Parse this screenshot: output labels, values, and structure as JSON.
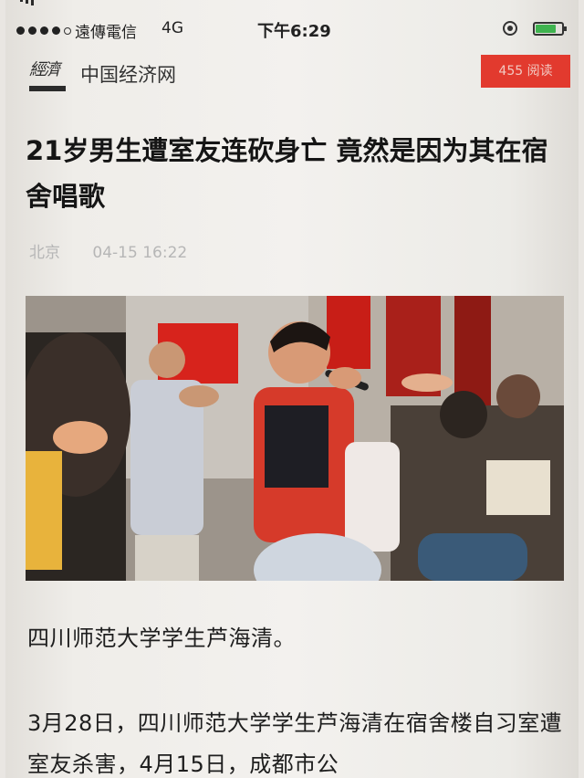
{
  "status_bar": {
    "carrier": "遠傳電信",
    "network": "4G",
    "time": "下午6:29",
    "battery_level": 0.8
  },
  "source": {
    "logo_icon": "zhongguo-jingji-logo",
    "name": "中国经济网",
    "views_badge": "455 阅读"
  },
  "article": {
    "title": "21岁男生遭室友连砍身亡 竟然是因为其在宿舍唱歌",
    "meta_source": "北京",
    "meta_datetime": "04-15 16:22",
    "paragraphs": [
      "四川师范大学学生芦海清。",
      "3月28日，四川师范大学学生芦海清在宿舍楼自习室遭室友杀害，4月15日，成都市公"
    ]
  },
  "colors": {
    "accent_red": "#e23a2e",
    "battery_green": "#3fb34f",
    "meta_gray": "#b6b6b6"
  }
}
